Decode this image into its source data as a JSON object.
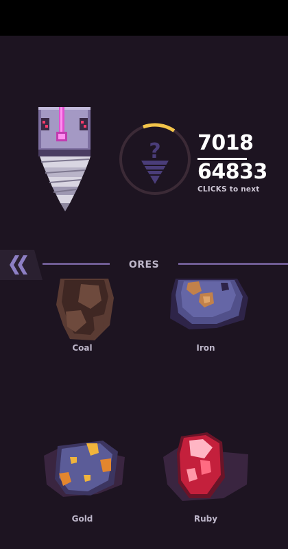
{
  "drill": {
    "icon": "drill-icon",
    "progress_fraction": 0.15,
    "ring_icon": "question-mark-icon",
    "clicks_current": "7018",
    "clicks_total": "64833",
    "clicks_caption": "CLICKS to next"
  },
  "section": {
    "title": "ORES",
    "back_icon": "double-chevron-left-icon"
  },
  "ores": [
    {
      "name": "Coal",
      "icon": "coal-ore-icon"
    },
    {
      "name": "Iron",
      "icon": "iron-ore-icon"
    },
    {
      "name": "Gold",
      "icon": "gold-ore-icon"
    },
    {
      "name": "Ruby",
      "icon": "ruby-ore-icon"
    }
  ],
  "colors": {
    "background": "#1d1421",
    "accent_ring": "#f3c44a",
    "divider": "#6f5c93",
    "drill_pink": "#e24fd0"
  }
}
